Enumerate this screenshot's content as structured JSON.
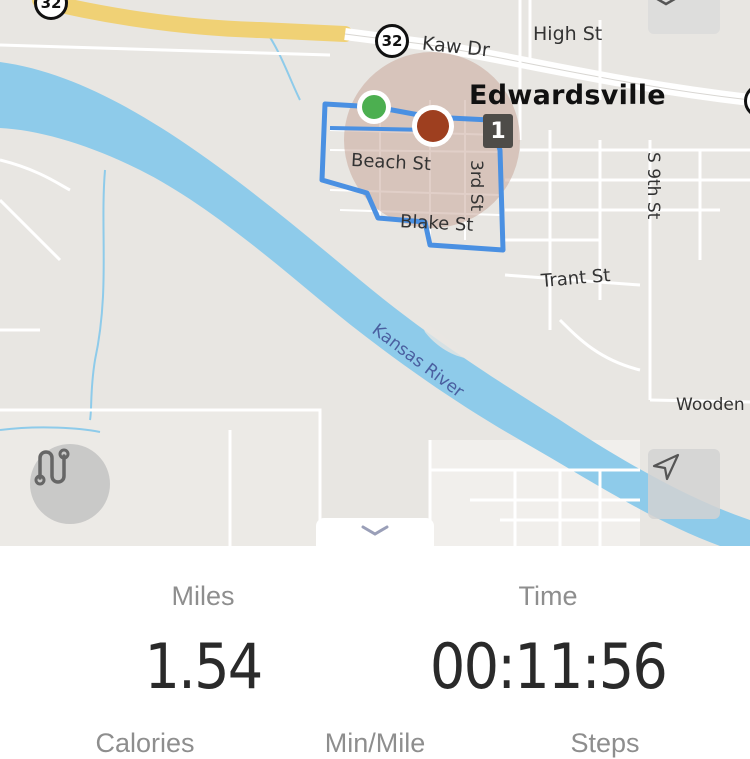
{
  "map": {
    "city": "Edwardsville",
    "river": "Kansas River",
    "streets": [
      "High St",
      "Kaw Dr",
      "Beach St",
      "Blake St",
      "3rd St",
      "S 9th St",
      "Trant St",
      "Wooden"
    ],
    "highway_shield": "32",
    "lap_marker": "1",
    "colors": {
      "water": "#8ecbea",
      "route": "#4a90e2",
      "highway": "#f0d175",
      "land": "#e8e6e2",
      "start_marker": "#4caf50",
      "end_marker": "#9e3f1f"
    }
  },
  "controls": {
    "route_icon": "route-icon",
    "locate_icon": "navigation-arrow-icon",
    "layers_icon": "layers-icon",
    "collapse_icon": "chevron-down-icon"
  },
  "stats": {
    "miles_label": "Miles",
    "miles_value": "1.54",
    "time_label": "Time",
    "time_value": "00:11:56",
    "calories_label": "Calories",
    "pace_label": "Min/Mile",
    "steps_label": "Steps"
  }
}
